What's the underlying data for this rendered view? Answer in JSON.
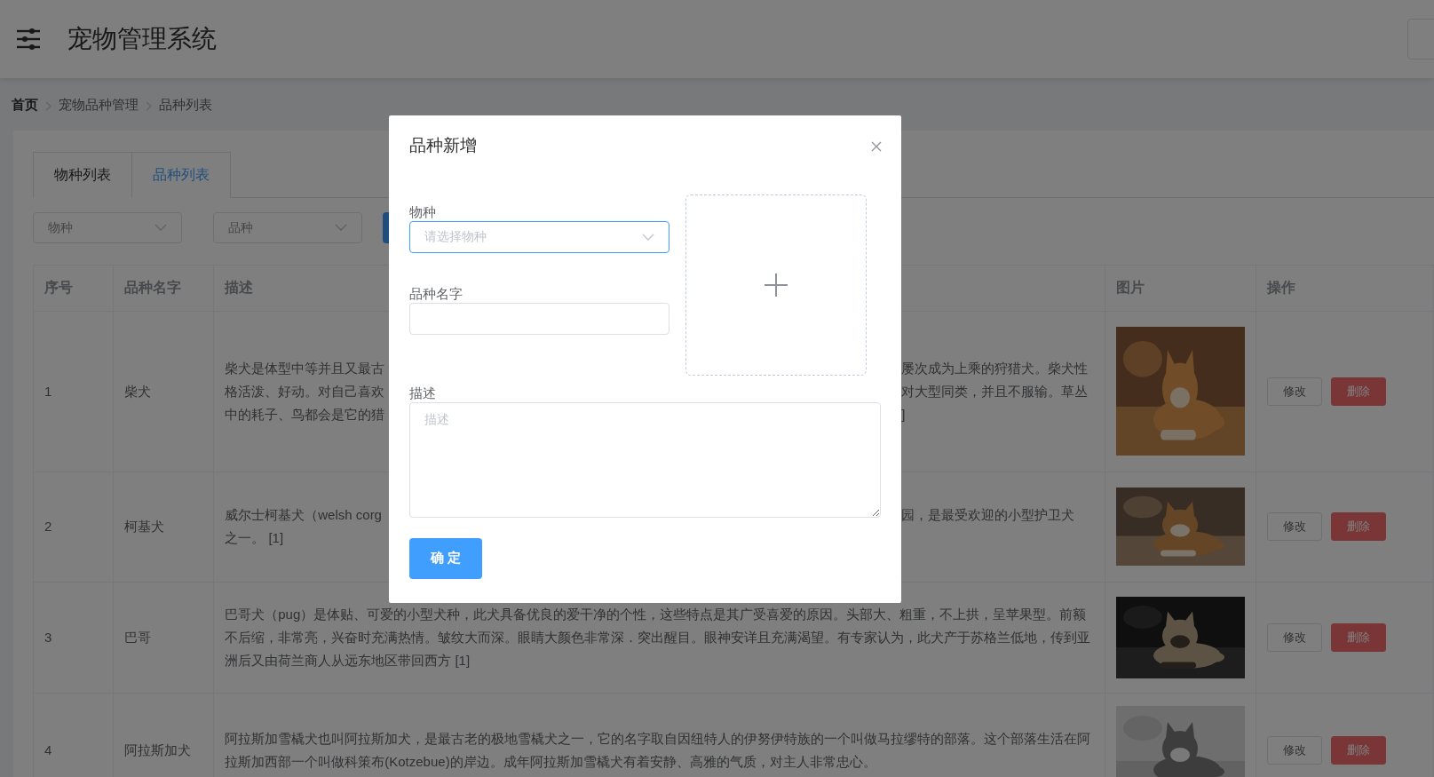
{
  "header": {
    "title": "宠物管理系统"
  },
  "breadcrumb": [
    "首页",
    "宠物品种管理",
    "品种列表"
  ],
  "tabs": [
    {
      "label": "物种列表",
      "selected": false
    },
    {
      "label": "品种列表",
      "selected": true
    }
  ],
  "filters": [
    {
      "placeholder": "物种"
    },
    {
      "placeholder": "品种"
    }
  ],
  "table": {
    "columns": [
      "序号",
      "品种名字",
      "描述",
      "图片",
      "操作"
    ],
    "rows": [
      {
        "index": "1",
        "name": "柴犬",
        "description_left": [
          "柴犬是体型中等并且又最古",
          "格活泼、好动。对自己喜欢",
          "中的耗子、鸟都会是它的猎"
        ],
        "description_right": [
          "屡次成为上乘的狩猎犬。柴犬性",
          "对大型同类，并且不服输。草丛",
          "]"
        ],
        "actions": [
          "修改",
          "删除"
        ]
      },
      {
        "index": "2",
        "name": "柯基犬",
        "description_left": [
          "威尔士柯基犬（welsh corg",
          "之一。 [1]"
        ],
        "description_right": [
          "园，是最受欢迎的小型护卫犬"
        ],
        "actions": [
          "修改",
          "删除"
        ]
      },
      {
        "index": "3",
        "name": "巴哥",
        "description": "巴哥犬（pug）是体贴、可爱的小型犬种，此犬具备优良的爱干净的个性，这些特点是其广受喜爱的原因。头部大、粗重，不上拱，呈苹果型。前额不后缩，非常亮，兴奋时充满热情。皱纹大而深。眼睛大颜色非常深．突出醒目。眼神安详且充满渴望。有专家认为，此犬产于苏格兰低地，传到亚洲后又由荷兰商人从远东地区带回西方 [1]",
        "actions": [
          "修改",
          "删除"
        ]
      },
      {
        "index": "4",
        "name": "阿拉斯加犬",
        "description": "阿拉斯加雪橇犬也叫阿拉斯加犬，是最古老的极地雪橇犬之一，它的名字取自因纽特人的伊努伊特族的一个叫做马拉缪特的部落。这个部落生活在阿拉斯加西部一个叫做科策布(Kotzebue)的岸边。成年阿拉斯加雪橇犬有着安静、高雅的气质，对主人非常忠心。",
        "actions": [
          "修改",
          "删除"
        ]
      }
    ]
  },
  "dialog": {
    "title": "品种新增",
    "fields": [
      {
        "kind": "select",
        "label": "物种",
        "placeholder": "请选择物种",
        "focused": true
      },
      {
        "kind": "input",
        "label": "品种名字",
        "focused": false
      },
      {
        "kind": "textarea",
        "label": "描述",
        "placeholder": "描述",
        "focused": false
      }
    ],
    "submit": "确 定"
  }
}
